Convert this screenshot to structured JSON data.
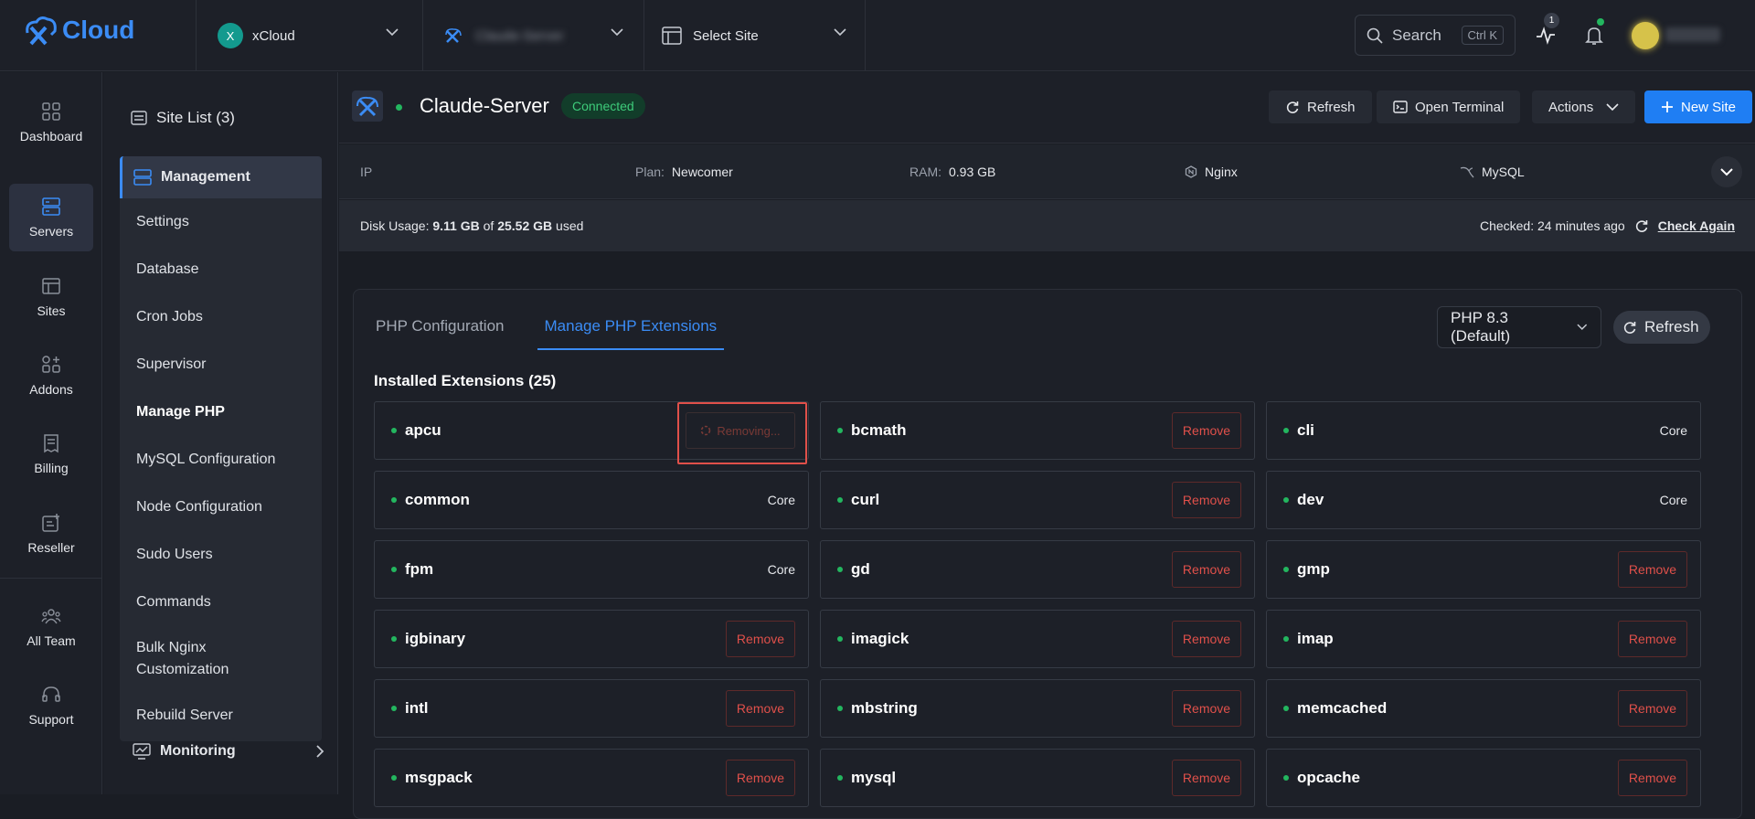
{
  "brand": {
    "name": "Cloud",
    "accent": "#1f7ef3"
  },
  "topbar": {
    "team": {
      "initial": "X",
      "label": "xCloud"
    },
    "server_select": {
      "label": "Claude-Server"
    },
    "site_select": {
      "label": "Select Site"
    },
    "search": {
      "label": "Search",
      "shortcut": "Ctrl K"
    },
    "activity_count": "1"
  },
  "leftnav": [
    {
      "label": "Dashboard",
      "icon": "grid-icon",
      "active": false
    },
    {
      "label": "Servers",
      "icon": "server-icon",
      "active": true
    },
    {
      "label": "Sites",
      "icon": "browser-icon",
      "active": false
    },
    {
      "label": "Addons",
      "icon": "addons-icon",
      "active": false
    },
    {
      "label": "Billing",
      "icon": "receipt-icon",
      "active": false
    },
    {
      "label": "Reseller",
      "icon": "reseller-icon",
      "active": false
    },
    {
      "label": "All Team",
      "icon": "team-icon",
      "active": false
    },
    {
      "label": "Support",
      "icon": "headset-icon",
      "active": false
    }
  ],
  "subnav": {
    "site_list": "Site List (3)",
    "management": "Management",
    "items": [
      "Settings",
      "Database",
      "Cron Jobs",
      "Supervisor",
      "Manage PHP",
      "MySQL Configuration",
      "Node Configuration",
      "Sudo Users",
      "Commands",
      "Bulk Nginx Customization",
      "Rebuild Server"
    ],
    "active_item": "Manage PHP",
    "monitoring": "Monitoring"
  },
  "server": {
    "name": "Claude-Server",
    "status": "Connected",
    "buttons": {
      "refresh": "Refresh",
      "terminal": "Open Terminal",
      "actions": "Actions",
      "new_site": "New Site"
    }
  },
  "info": {
    "ip_label": "IP",
    "plan_label": "Plan:",
    "plan": "Newcomer",
    "ram_label": "RAM:",
    "ram": "0.93 GB",
    "web_server": "Nginx",
    "database": "MySQL"
  },
  "disk": {
    "label": "Disk Usage:",
    "used": "9.11 GB",
    "of": "of",
    "total": "25.52 GB",
    "suffix": "used",
    "checked": "Checked: 24 minutes ago",
    "check_again": "Check Again"
  },
  "php": {
    "tabs": [
      "PHP Configuration",
      "Manage PHP Extensions"
    ],
    "active_tab": "Manage PHP Extensions",
    "version": "PHP 8.3 (Default)",
    "refresh": "Refresh",
    "installed_label": "Installed Extensions (25)",
    "extensions": [
      {
        "name": "apcu",
        "action": "Removing..."
      },
      {
        "name": "bcmath",
        "action": "Remove"
      },
      {
        "name": "cli",
        "action": "Core"
      },
      {
        "name": "common",
        "action": "Core"
      },
      {
        "name": "curl",
        "action": "Remove"
      },
      {
        "name": "dev",
        "action": "Core"
      },
      {
        "name": "fpm",
        "action": "Core"
      },
      {
        "name": "gd",
        "action": "Remove"
      },
      {
        "name": "gmp",
        "action": "Remove"
      },
      {
        "name": "igbinary",
        "action": "Remove"
      },
      {
        "name": "imagick",
        "action": "Remove"
      },
      {
        "name": "imap",
        "action": "Remove"
      },
      {
        "name": "intl",
        "action": "Remove"
      },
      {
        "name": "mbstring",
        "action": "Remove"
      },
      {
        "name": "memcached",
        "action": "Remove"
      },
      {
        "name": "msgpack",
        "action": "Remove"
      },
      {
        "name": "mysql",
        "action": "Remove"
      },
      {
        "name": "opcache",
        "action": "Remove"
      }
    ]
  }
}
